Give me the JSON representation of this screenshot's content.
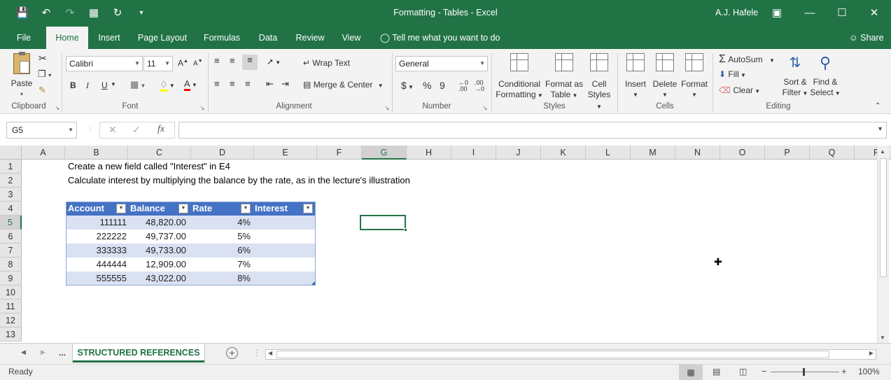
{
  "window": {
    "title": "Formatting - Tables  -  Excel",
    "user": "A.J. Hafele"
  },
  "ribbon_tabs": [
    "File",
    "Home",
    "Insert",
    "Page Layout",
    "Formulas",
    "Data",
    "Review",
    "View"
  ],
  "active_tab": "Home",
  "tell_me": "Tell me what you want to do",
  "share": "Share",
  "ribbon": {
    "clipboard": {
      "label": "Clipboard",
      "paste": "Paste"
    },
    "font": {
      "label": "Font",
      "name": "Calibri",
      "size": "11",
      "bold": "B",
      "italic": "I",
      "underline": "U"
    },
    "alignment": {
      "label": "Alignment",
      "wrap_text": "Wrap Text",
      "merge_center": "Merge & Center"
    },
    "number": {
      "label": "Number",
      "format": "General",
      "currency": "$",
      "percent": "%",
      "comma": "9"
    },
    "styles": {
      "label": "Styles",
      "conditional_1": "Conditional",
      "conditional_2": "Formatting",
      "format_as_1": "Format as",
      "format_as_2": "Table",
      "cell_styles_1": "Cell",
      "cell_styles_2": "Styles"
    },
    "cells": {
      "label": "Cells",
      "insert": "Insert",
      "delete": "Delete",
      "format": "Format"
    },
    "editing": {
      "label": "Editing",
      "autosum": "AutoSum",
      "fill": "Fill",
      "clear": "Clear",
      "sort_1": "Sort &",
      "sort_2": "Filter",
      "find_1": "Find &",
      "find_2": "Select"
    }
  },
  "name_box": "G5",
  "formula": "",
  "columns": [
    "A",
    "B",
    "C",
    "D",
    "E",
    "F",
    "G",
    "H",
    "I",
    "J",
    "K",
    "L",
    "M",
    "N",
    "O",
    "P",
    "Q",
    "R"
  ],
  "selected_column": "G",
  "rows": [
    "1",
    "2",
    "3",
    "4",
    "5",
    "6",
    "7",
    "8",
    "9",
    "10",
    "11",
    "12",
    "13"
  ],
  "selected_row": "5",
  "instructions": {
    "line1": "Create a new field called \"Interest\" in E4",
    "line2": "Calculate interest by multiplying the balance by the rate, as in the lecture's  illustration"
  },
  "table": {
    "headers": [
      "Account",
      "Balance",
      "Rate",
      "Interest"
    ],
    "rows": [
      [
        "111111",
        "48,820.00",
        "4%",
        ""
      ],
      [
        "222222",
        "49,737.00",
        "5%",
        ""
      ],
      [
        "333333",
        "49,733.00",
        "6%",
        ""
      ],
      [
        "444444",
        "12,909.00",
        "7%",
        ""
      ],
      [
        "555555",
        "43,022.00",
        "8%",
        ""
      ]
    ],
    "header_color": "#4472c4",
    "band_color": "#d9e1f2"
  },
  "sheet_tabs": {
    "ellipsis": "...",
    "active": "STRUCTURED REFERENCES"
  },
  "status": {
    "ready": "Ready",
    "zoom": "100%"
  },
  "accent_color": "#217346"
}
